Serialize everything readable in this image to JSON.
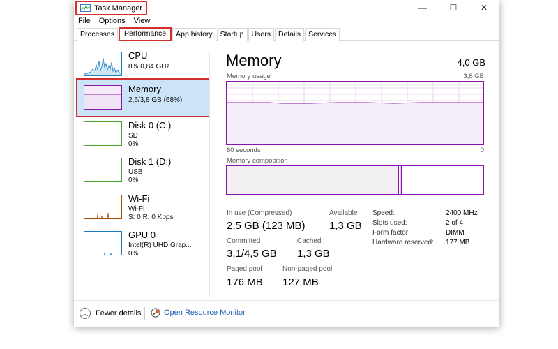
{
  "window": {
    "title": "Task Manager",
    "controls": {
      "minimize": "—",
      "maximize": "☐",
      "close": "✕"
    }
  },
  "menu": [
    "File",
    "Options",
    "View"
  ],
  "tabs": [
    "Processes",
    "Performance",
    "App history",
    "Startup",
    "Users",
    "Details",
    "Services"
  ],
  "active_tab": "Performance",
  "resources": [
    {
      "name": "CPU",
      "line1": "8% 0,84 GHz",
      "line2": "",
      "color": "#1a7dc1"
    },
    {
      "name": "Memory",
      "line1": "2,6/3,8 GB (68%)",
      "line2": "",
      "color": "#8b12ae"
    },
    {
      "name": "Disk 0 (C:)",
      "line1": "SD",
      "line2": "0%",
      "color": "#4ca52b"
    },
    {
      "name": "Disk 1 (D:)",
      "line1": "USB",
      "line2": "0%",
      "color": "#4ca52b"
    },
    {
      "name": "Wi-Fi",
      "line1": "Wi-Fi",
      "line2": "S: 0 R: 0 Kbps",
      "color": "#a74f01"
    },
    {
      "name": "GPU 0",
      "line1": "Intel(R) UHD Grap...",
      "line2": "0%",
      "color": "#1a7dc1"
    }
  ],
  "memory": {
    "title": "Memory",
    "total": "4,0 GB",
    "usage_label": "Memory usage",
    "usage_max": "3,8 GB",
    "time_left": "60 seconds",
    "time_right": "0",
    "composition_label": "Memory composition",
    "in_use_fraction": 0.67,
    "stats": {
      "in_use_label": "In use (Compressed)",
      "in_use_value": "2,5 GB (123 MB)",
      "available_label": "Available",
      "available_value": "1,3 GB",
      "committed_label": "Committed",
      "committed_value": "3,1/4,5 GB",
      "cached_label": "Cached",
      "cached_value": "1,3 GB",
      "paged_label": "Paged pool",
      "paged_value": "176 MB",
      "nonpaged_label": "Non-paged pool",
      "nonpaged_value": "127 MB"
    },
    "specs": [
      {
        "label": "Speed:",
        "value": "2400 MHz"
      },
      {
        "label": "Slots used:",
        "value": "2 of 4"
      },
      {
        "label": "Form factor:",
        "value": "DIMM"
      },
      {
        "label": "Hardware reserved:",
        "value": "177 MB"
      }
    ]
  },
  "footer": {
    "fewer_details": "Fewer details",
    "resource_monitor": "Open Resource Monitor"
  },
  "colors": {
    "memory": "#8b12ae",
    "selected_bg": "#cce4f7",
    "highlight": "#d32f2f",
    "link": "#1a5fb4"
  }
}
